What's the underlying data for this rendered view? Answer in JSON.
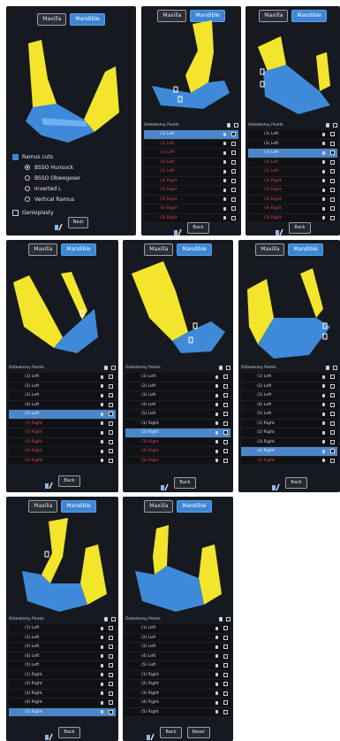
{
  "toggle": {
    "maxilla": "Maxilla",
    "mandible": "Mandible"
  },
  "list_header": "Osteotomy Points",
  "buttons": {
    "next": "Next",
    "back": "Back",
    "reset": "Reset"
  },
  "options": {
    "ramus_cuts": "Ramus cuts",
    "bsso_hunsuck": "BSSO Hunsuck",
    "bsso_obwegeser": "BSSO Obwegeser",
    "inverted_l": "Inverted L",
    "vertical_ramus": "Vertical Ramus",
    "genioplasty": "Genioplasty"
  },
  "panels": [
    {
      "rows": [
        {
          "label": "(1) Left",
          "state": "sel"
        },
        {
          "label": "(2) Left",
          "state": "red"
        },
        {
          "label": "(3) Left",
          "state": "red"
        },
        {
          "label": "(4) Left",
          "state": "red"
        },
        {
          "label": "(5) Left",
          "state": "red"
        },
        {
          "label": "(1) Right",
          "state": "red"
        },
        {
          "label": "(2) Right",
          "state": "red"
        },
        {
          "label": "(3) Right",
          "state": "red"
        },
        {
          "label": "(4) Right",
          "state": "red"
        },
        {
          "label": "(5) Right",
          "state": "red"
        }
      ]
    },
    {
      "rows": [
        {
          "label": "(1) Left",
          "state": "normal"
        },
        {
          "label": "(2) Left",
          "state": "normal"
        },
        {
          "label": "(3) Left",
          "state": "sel"
        },
        {
          "label": "(4) Left",
          "state": "red"
        },
        {
          "label": "(5) Left",
          "state": "red"
        },
        {
          "label": "(1) Right",
          "state": "red"
        },
        {
          "label": "(2) Right",
          "state": "red"
        },
        {
          "label": "(3) Right",
          "state": "red"
        },
        {
          "label": "(4) Right",
          "state": "red"
        },
        {
          "label": "(5) Right",
          "state": "red"
        }
      ]
    },
    {
      "rows": [
        {
          "label": "(1) Left",
          "state": "normal"
        },
        {
          "label": "(2) Left",
          "state": "normal"
        },
        {
          "label": "(3) Left",
          "state": "normal"
        },
        {
          "label": "(4) Left",
          "state": "normal"
        },
        {
          "label": "(5) Left",
          "state": "sel"
        },
        {
          "label": "(1) Right",
          "state": "red"
        },
        {
          "label": "(2) Right",
          "state": "red"
        },
        {
          "label": "(3) Right",
          "state": "red"
        },
        {
          "label": "(4) Right",
          "state": "red"
        },
        {
          "label": "(5) Right",
          "state": "red"
        }
      ]
    },
    {
      "rows": [
        {
          "label": "(1) Left",
          "state": "normal"
        },
        {
          "label": "(2) Left",
          "state": "normal"
        },
        {
          "label": "(3) Left",
          "state": "normal"
        },
        {
          "label": "(4) Left",
          "state": "normal"
        },
        {
          "label": "(5) Left",
          "state": "normal"
        },
        {
          "label": "(1) Right",
          "state": "normal"
        },
        {
          "label": "(2) Right",
          "state": "sel"
        },
        {
          "label": "(3) Right",
          "state": "red"
        },
        {
          "label": "(4) Right",
          "state": "red"
        },
        {
          "label": "(5) Right",
          "state": "red"
        }
      ]
    },
    {
      "rows": [
        {
          "label": "(1) Left",
          "state": "normal"
        },
        {
          "label": "(2) Left",
          "state": "normal"
        },
        {
          "label": "(3) Left",
          "state": "normal"
        },
        {
          "label": "(4) Left",
          "state": "normal"
        },
        {
          "label": "(5) Left",
          "state": "normal"
        },
        {
          "label": "(1) Right",
          "state": "normal"
        },
        {
          "label": "(2) Right",
          "state": "normal"
        },
        {
          "label": "(3) Right",
          "state": "normal"
        },
        {
          "label": "(4) Right",
          "state": "sel"
        },
        {
          "label": "(5) Right",
          "state": "red"
        }
      ]
    },
    {
      "rows": [
        {
          "label": "(1) Left",
          "state": "normal"
        },
        {
          "label": "(2) Left",
          "state": "normal"
        },
        {
          "label": "(3) Left",
          "state": "normal"
        },
        {
          "label": "(4) Left",
          "state": "normal"
        },
        {
          "label": "(5) Left",
          "state": "normal"
        },
        {
          "label": "(1) Right",
          "state": "normal"
        },
        {
          "label": "(2) Right",
          "state": "normal"
        },
        {
          "label": "(3) Right",
          "state": "normal"
        },
        {
          "label": "(4) Right",
          "state": "normal"
        },
        {
          "label": "(5) Right",
          "state": "sel"
        }
      ]
    },
    {
      "rows": [
        {
          "label": "(1) Left",
          "state": "normal"
        },
        {
          "label": "(2) Left",
          "state": "normal"
        },
        {
          "label": "(3) Left",
          "state": "normal"
        },
        {
          "label": "(4) Left",
          "state": "normal"
        },
        {
          "label": "(5) Left",
          "state": "normal"
        },
        {
          "label": "(1) Right",
          "state": "normal"
        },
        {
          "label": "(2) Right",
          "state": "normal"
        },
        {
          "label": "(3) Right",
          "state": "normal"
        },
        {
          "label": "(4) Right",
          "state": "normal"
        },
        {
          "label": "(5) Right",
          "state": "normal"
        }
      ]
    }
  ],
  "colors": {
    "bone_yellow": "#f2e52c",
    "bone_blue": "#3f8ad8",
    "selection": "#4b86c9",
    "pending_red": "#e64545"
  }
}
